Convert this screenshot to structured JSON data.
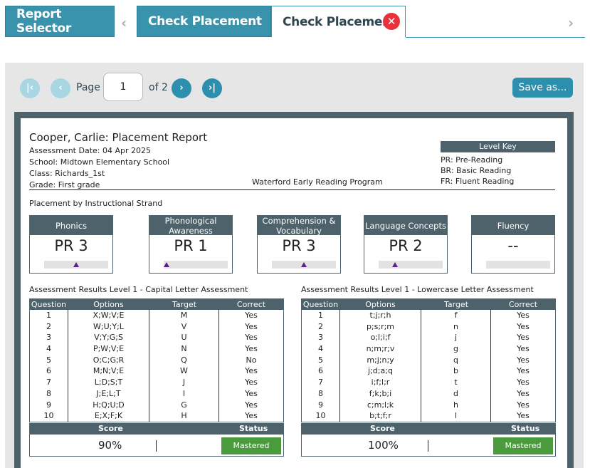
{
  "tabs": [
    {
      "label": "Report Selector"
    },
    {
      "label": "Check Placement"
    },
    {
      "label": "Check Placement",
      "active": true,
      "close_glyph": "✕"
    }
  ],
  "tab_scroll": {
    "left_glyph": "‹",
    "right_glyph": "›"
  },
  "pager": {
    "first_glyph": "|‹",
    "prev_glyph": "‹",
    "next_glyph": "›",
    "last_glyph": "›|",
    "page_label": "Page",
    "page_value": "1",
    "of_label": "of 2"
  },
  "save_label": "Save as...",
  "report": {
    "title": "Cooper, Carlie: Placement Report",
    "assessment_date": "Assessment Date: 04 Apr 2025",
    "school": "School: Midtown Elementary School",
    "class": "Class: Richards_1st",
    "grade": "Grade: First grade",
    "program": "Waterford Early Reading Program",
    "level_key": {
      "title": "Level Key",
      "items": [
        "PR: Pre-Reading",
        "BR: Basic Reading",
        "FR: Fluent Reading"
      ]
    },
    "strand_label": "Placement by Instructional Strand",
    "strands": [
      {
        "name": "Phonics",
        "value": "PR 3",
        "level_fraction": 0.5
      },
      {
        "name": "Phonological Awareness",
        "value": "PR 1",
        "level_fraction": 0.0
      },
      {
        "name": "Comprehension & Vocabulary",
        "value": "PR 3",
        "level_fraction": 0.5
      },
      {
        "name": "Language Concepts",
        "value": "PR 2",
        "level_fraction": 0.25
      },
      {
        "name": "Fluency",
        "value": "--",
        "level_fraction": null
      }
    ],
    "tables": [
      {
        "title": "Assessment Results Level 1 - Capital Letter Assessment",
        "headers": [
          "Question",
          "Options",
          "Target",
          "Correct"
        ],
        "rows": [
          [
            "1",
            "X;W;V;E",
            "M",
            "Yes"
          ],
          [
            "2",
            "W;U;Y;L",
            "V",
            "Yes"
          ],
          [
            "3",
            "V;Y;G;S",
            "U",
            "Yes"
          ],
          [
            "4",
            "P;W;V;E",
            "N",
            "Yes"
          ],
          [
            "5",
            "O;C;G;R",
            "Q",
            "No"
          ],
          [
            "6",
            "M;N;V;E",
            "W",
            "Yes"
          ],
          [
            "7",
            "L;D;S;T",
            "J",
            "Yes"
          ],
          [
            "8",
            "J;E;L;T",
            "I",
            "Yes"
          ],
          [
            "9",
            "H;Q;U;D",
            "G",
            "Yes"
          ],
          [
            "10",
            "E;X;F;K",
            "H",
            "Yes"
          ]
        ],
        "score_label": "Score",
        "status_label": "Status",
        "score": "90%",
        "status": "Mastered"
      },
      {
        "title": "Assessment Results Level 1 - Lowercase Letter Assessment",
        "headers": [
          "Question",
          "Options",
          "Target",
          "Correct"
        ],
        "rows": [
          [
            "1",
            "t;j;r;h",
            "f",
            "Yes"
          ],
          [
            "2",
            "p;s;r;m",
            "n",
            "Yes"
          ],
          [
            "3",
            "o;l;i;f",
            "j",
            "Yes"
          ],
          [
            "4",
            "n;m;r;v",
            "g",
            "Yes"
          ],
          [
            "5",
            "m;j;n;y",
            "q",
            "Yes"
          ],
          [
            "6",
            "j;d;a;q",
            "b",
            "Yes"
          ],
          [
            "7",
            "i;f;l;r",
            "t",
            "Yes"
          ],
          [
            "8",
            "f;k;b;i",
            "d",
            "Yes"
          ],
          [
            "9",
            "c;m;l;k",
            "h",
            "Yes"
          ],
          [
            "10",
            "b;t;f;r",
            "l",
            "Yes"
          ]
        ],
        "score_label": "Score",
        "status_label": "Status",
        "score": "100%",
        "status": "Mastered"
      }
    ]
  },
  "colors": {
    "teal": "#3a93ad",
    "slate": "#4e626c",
    "mastered": "#4a9b3c",
    "close": "#e8313a",
    "marker": "#5b1f8a"
  }
}
